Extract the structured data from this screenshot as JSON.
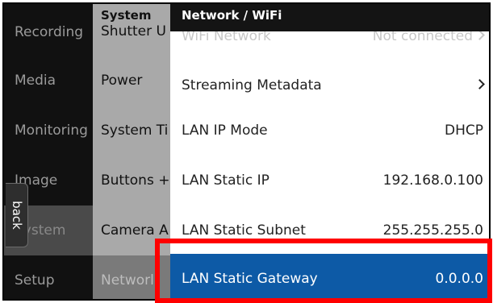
{
  "level1": {
    "items": [
      "Recording",
      "Media",
      "Monitoring",
      "Image",
      "System",
      "Setup"
    ],
    "selected_index": 4
  },
  "level2": {
    "title": "System",
    "items": [
      "Shutter U",
      "Power",
      "System Ti",
      "Buttons +",
      "Camera A",
      "Networl"
    ],
    "selected_index": 5
  },
  "panel": {
    "title": "Network / WiFi",
    "partial_row": {
      "label": "WiFi Network",
      "value": "Not connected"
    },
    "rows": [
      {
        "label": "Streaming Metadata",
        "value": ""
      },
      {
        "label": "LAN IP Mode",
        "value": "DHCP"
      },
      {
        "label": "LAN Static IP",
        "value": "192.168.0.100"
      },
      {
        "label": "LAN Static Subnet",
        "value": "255.255.255.0"
      },
      {
        "label": "LAN Static Gateway",
        "value": "0.0.0.0"
      }
    ]
  },
  "back_tab": {
    "label": "back"
  },
  "colors": {
    "selection": "#0d5aa6",
    "highlight": "#ff0000",
    "sidebar_bg": "#111111",
    "submenu_bg": "#a9a9a9"
  },
  "icons": [
    "chevron-right-icon"
  ]
}
